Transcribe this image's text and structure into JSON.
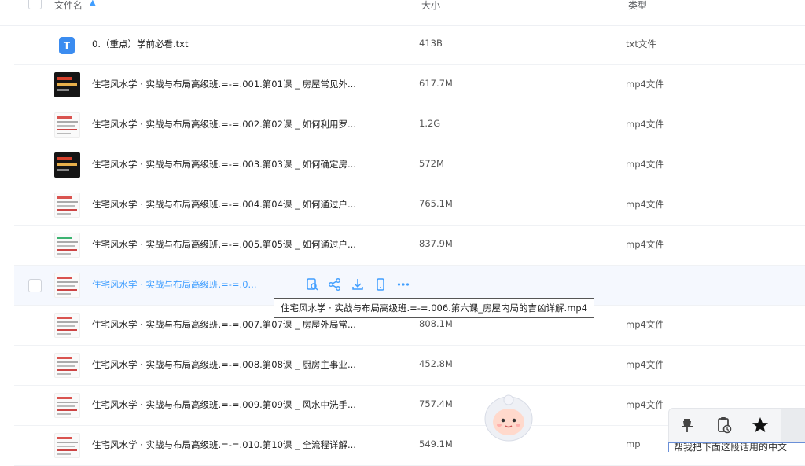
{
  "header": {
    "name_label": "文件名",
    "size_label": "大小",
    "type_label": "类型"
  },
  "rows": [
    {
      "name": "0.（重点）学前必看.txt",
      "size": "413B",
      "type": "txt文件",
      "icon": "txt-file-icon"
    },
    {
      "name": "住宅风水学 · 实战与布局高级班.=-=.001.第01课 _ 房屋常见外...",
      "size": "617.7M",
      "type": "mp4文件",
      "icon": "video-thumbnail"
    },
    {
      "name": "住宅风水学 · 实战与布局高级班.=-=.002.第02课 _ 如何利用罗...",
      "size": "1.2G",
      "type": "mp4文件",
      "icon": "video-thumbnail"
    },
    {
      "name": "住宅风水学 · 实战与布局高级班.=-=.003.第03课 _ 如何确定房...",
      "size": "572M",
      "type": "mp4文件",
      "icon": "video-thumbnail"
    },
    {
      "name": "住宅风水学 · 实战与布局高级班.=-=.004.第04课 _ 如何通过户...",
      "size": "765.1M",
      "type": "mp4文件",
      "icon": "video-thumbnail"
    },
    {
      "name": "住宅风水学 · 实战与布局高级班.=-=.005.第05课 _ 如何通过户...",
      "size": "837.9M",
      "type": "mp4文件",
      "icon": "video-thumbnail"
    },
    {
      "name": "住宅风水学 · 实战与布局高级班.=-=.0...",
      "size": "",
      "type": "",
      "icon": "video-thumbnail"
    },
    {
      "name": "住宅风水学 · 实战与布局高级班.=-=.007.第07课 _ 房屋外局常...",
      "size": "808.1M",
      "type": "mp4文件",
      "icon": "video-thumbnail"
    },
    {
      "name": "住宅风水学 · 实战与布局高级班.=-=.008.第08课 _ 厨房主事业...",
      "size": "452.8M",
      "type": "mp4文件",
      "icon": "video-thumbnail"
    },
    {
      "name": "住宅风水学 · 实战与布局高级班.=-=.009.第09课 _ 风水中洗手...",
      "size": "757.4M",
      "type": "mp4文件",
      "icon": "video-thumbnail"
    },
    {
      "name": "住宅风水学 · 实战与布局高级班.=-=.010.第10课 _ 全流程详解...",
      "size": "549.1M",
      "type": "mp",
      "icon": "video-thumbnail"
    }
  ],
  "tooltip": {
    "text": "住宅风水学 · 实战与布局高级班.=-=.006.第六课_房屋内局的吉凶详解.mp4"
  },
  "row_actions": [
    "preview-icon",
    "share-icon",
    "download-icon",
    "phone-icon",
    "more-icon"
  ],
  "toolbar": {
    "icons": [
      "pin-icon",
      "clipboard-history-icon",
      "star-icon"
    ]
  },
  "bottom_input": {
    "text": "帮我把下面这段话用的中文"
  },
  "colors": {
    "accent": "#409eff",
    "txt_icon": "#3b8cf0"
  }
}
